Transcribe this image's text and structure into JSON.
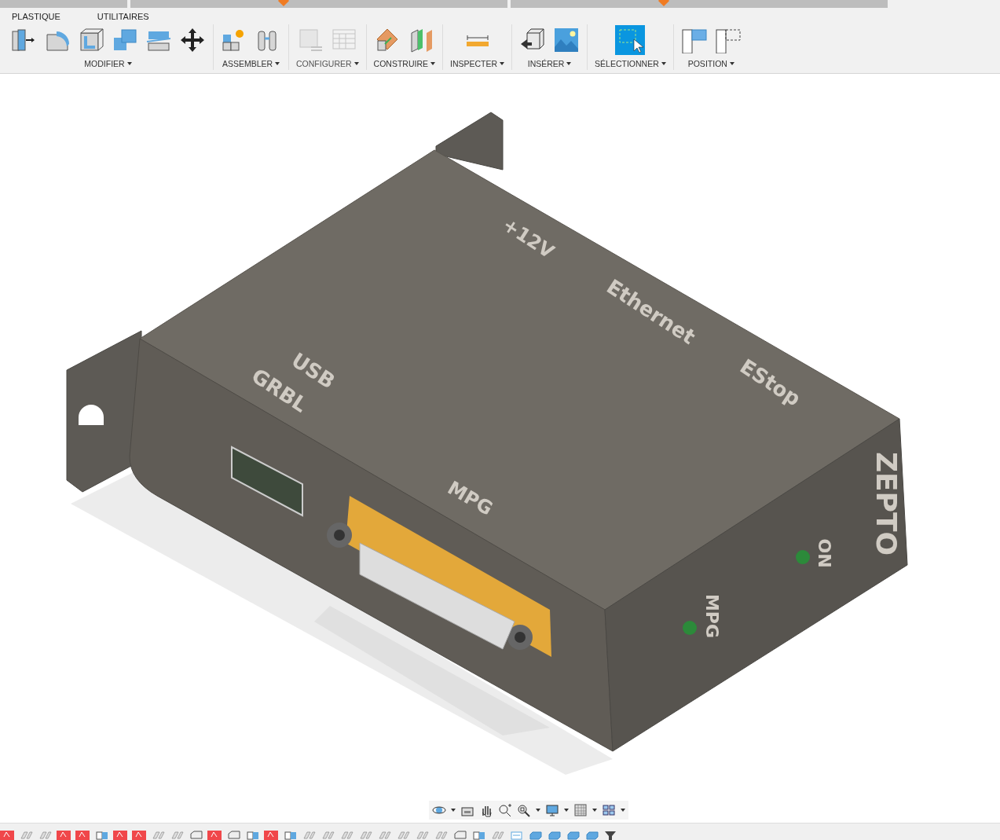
{
  "toolbar": {
    "tabs": [
      {
        "label": "PLASTIQUE"
      },
      {
        "label": "UTILITAIRES"
      }
    ],
    "groups": [
      {
        "label": "MODIFIER",
        "disabled": false,
        "tools": [
          {
            "kind": "press-pull"
          },
          {
            "kind": "fillet"
          },
          {
            "kind": "shell"
          },
          {
            "kind": "combine"
          },
          {
            "kind": "split"
          },
          {
            "kind": "move"
          }
        ]
      },
      {
        "label": "ASSEMBLER",
        "disabled": false,
        "tools": [
          {
            "kind": "new-component"
          },
          {
            "kind": "joint"
          }
        ]
      },
      {
        "label": "CONFIGURER",
        "disabled": true,
        "tools": [
          {
            "kind": "parameters"
          },
          {
            "kind": "table"
          }
        ]
      },
      {
        "label": "CONSTRUIRE",
        "disabled": false,
        "tools": [
          {
            "kind": "plane"
          },
          {
            "kind": "midplane"
          }
        ]
      },
      {
        "label": "INSPECTER",
        "disabled": false,
        "tools": [
          {
            "kind": "measure"
          }
        ]
      },
      {
        "label": "INSÉRER",
        "disabled": false,
        "tools": [
          {
            "kind": "insert"
          },
          {
            "kind": "image"
          }
        ]
      },
      {
        "label": "SÉLECTIONNER",
        "disabled": false,
        "tools": [
          {
            "kind": "select"
          }
        ]
      },
      {
        "label": "POSITION",
        "disabled": false,
        "tools": [
          {
            "kind": "capture"
          },
          {
            "kind": "revert"
          }
        ]
      }
    ]
  },
  "model": {
    "labels": [
      {
        "text": "+12V"
      },
      {
        "text": "Ethernet"
      },
      {
        "text": "EStop"
      },
      {
        "text": "USB"
      },
      {
        "text": "GRBL"
      },
      {
        "text": "MPG"
      },
      {
        "text": "ZEPTO"
      },
      {
        "text": "ON"
      },
      {
        "text": "MPG"
      }
    ]
  },
  "timeline": [
    {
      "kind": "error"
    },
    {
      "kind": "feature"
    },
    {
      "kind": "feature"
    },
    {
      "kind": "error"
    },
    {
      "kind": "error"
    },
    {
      "kind": "body"
    },
    {
      "kind": "error"
    },
    {
      "kind": "error"
    },
    {
      "kind": "feature"
    },
    {
      "kind": "feature"
    },
    {
      "kind": "sketch"
    },
    {
      "kind": "error"
    },
    {
      "kind": "sketch"
    },
    {
      "kind": "body"
    },
    {
      "kind": "error"
    },
    {
      "kind": "body"
    },
    {
      "kind": "feature"
    },
    {
      "kind": "feature"
    },
    {
      "kind": "feature"
    },
    {
      "kind": "feature"
    },
    {
      "kind": "feature"
    },
    {
      "kind": "feature"
    },
    {
      "kind": "feature"
    },
    {
      "kind": "feature"
    },
    {
      "kind": "sketch"
    },
    {
      "kind": "body"
    },
    {
      "kind": "feature"
    },
    {
      "kind": "plane"
    },
    {
      "kind": "box"
    },
    {
      "kind": "box"
    },
    {
      "kind": "box"
    },
    {
      "kind": "box"
    },
    {
      "kind": "marker"
    }
  ]
}
